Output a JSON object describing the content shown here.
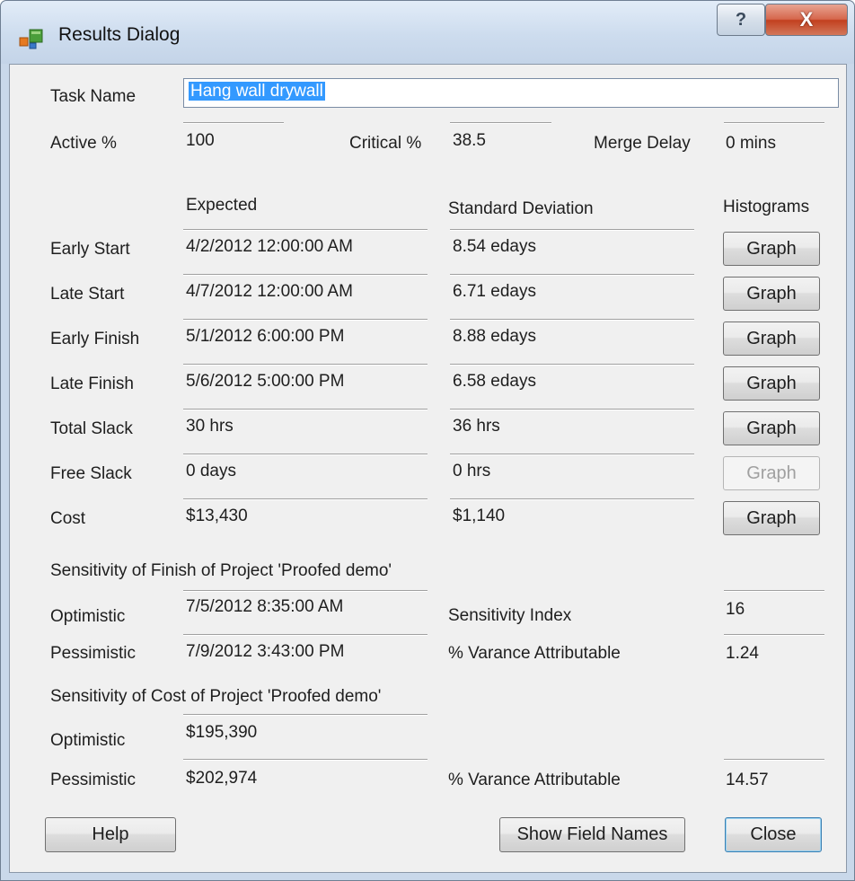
{
  "window": {
    "title": "Results Dialog",
    "help_glyph": "?",
    "close_glyph": "X"
  },
  "task": {
    "label": "Task Name",
    "value": "Hang wall drywall"
  },
  "summary": {
    "active_label": "Active %",
    "active_value": "100",
    "critical_label": "Critical %",
    "critical_value": "38.5",
    "merge_label": "Merge Delay",
    "merge_value": "0 mins"
  },
  "headers": {
    "expected": "Expected",
    "std_dev": "Standard Deviation",
    "histograms": "Histograms"
  },
  "rows": [
    {
      "label": "Early Start",
      "expected": "4/2/2012 12:00:00 AM",
      "std": "8.54 edays",
      "button": "Graph",
      "enabled": true
    },
    {
      "label": "Late Start",
      "expected": "4/7/2012 12:00:00 AM",
      "std": "6.71 edays",
      "button": "Graph",
      "enabled": true
    },
    {
      "label": "Early Finish",
      "expected": "5/1/2012 6:00:00 PM",
      "std": "8.88 edays",
      "button": "Graph",
      "enabled": true
    },
    {
      "label": "Late Finish",
      "expected": "5/6/2012 5:00:00 PM",
      "std": "6.58 edays",
      "button": "Graph",
      "enabled": true
    },
    {
      "label": "Total Slack",
      "expected": "30 hrs",
      "std": "36 hrs",
      "button": "Graph",
      "enabled": true
    },
    {
      "label": "Free Slack",
      "expected": "0 days",
      "std": "0 hrs",
      "button": "Graph",
      "enabled": false
    },
    {
      "label": "Cost",
      "expected": "$13,430",
      "std": "$1,140",
      "button": "Graph",
      "enabled": true
    }
  ],
  "finish_sensitivity": {
    "heading": "Sensitivity of Finish of Project 'Proofed demo'",
    "optimistic_label": "Optimistic",
    "optimistic_value": "7/5/2012 8:35:00 AM",
    "pessimistic_label": "Pessimistic",
    "pessimistic_value": "7/9/2012 3:43:00 PM",
    "index_label": "Sensitivity Index",
    "index_value": "16",
    "variance_label": "% Varance Attributable",
    "variance_value": "1.24"
  },
  "cost_sensitivity": {
    "heading": "Sensitivity of Cost of Project 'Proofed demo'",
    "optimistic_label": "Optimistic",
    "optimistic_value": "$195,390",
    "pessimistic_label": "Pessimistic",
    "pessimistic_value": "$202,974",
    "variance_label": "% Varance Attributable",
    "variance_value": "14.57"
  },
  "footer": {
    "help": "Help",
    "show_field_names": "Show Field Names",
    "close": "Close"
  }
}
